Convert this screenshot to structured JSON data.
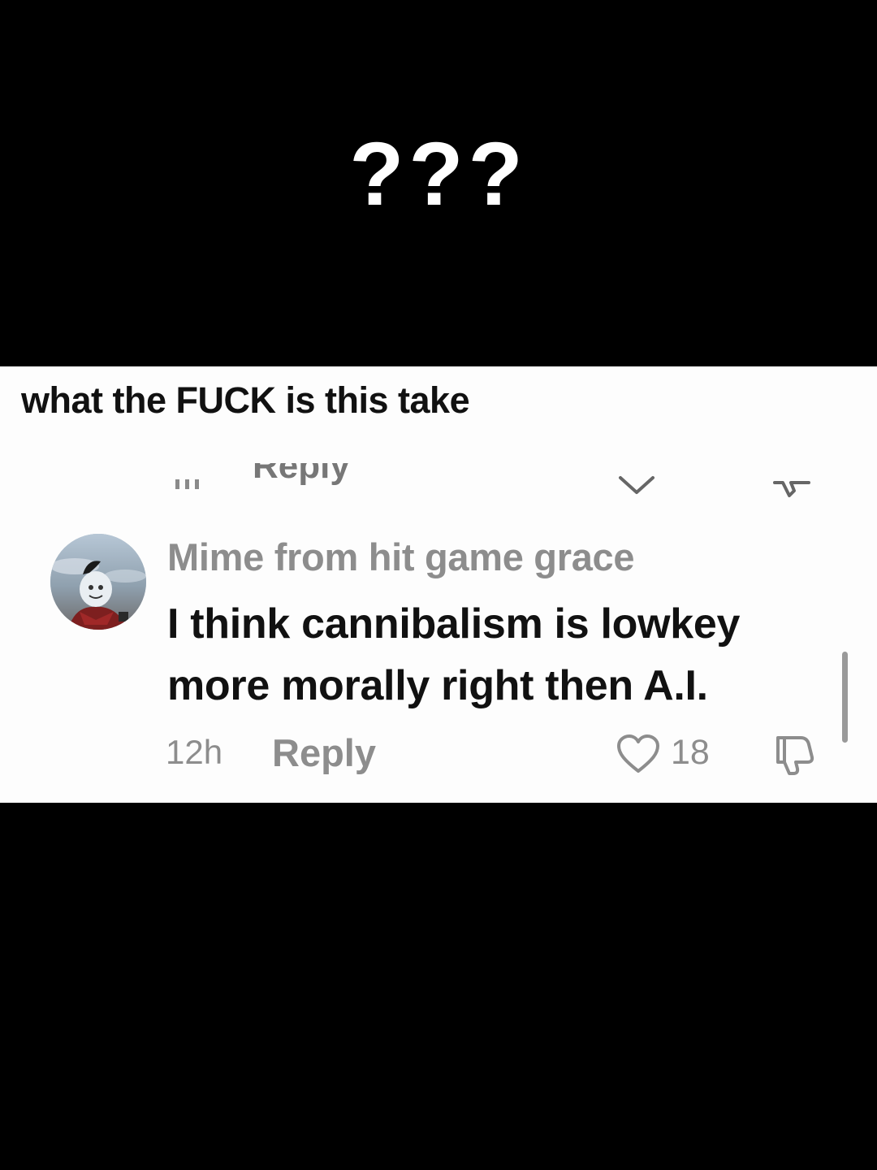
{
  "overlay": {
    "caption": "???"
  },
  "post": {
    "caption": "what the FUCK is this take"
  },
  "previous_comment": {
    "reply_label": "Reply"
  },
  "comment": {
    "username": "Mime from hit game grace",
    "text": "I think cannibalism is lowkey more morally right then A.I.",
    "time": "12h",
    "reply_label": "Reply",
    "like_count": "18",
    "icons": {
      "like": "heart-outline-icon",
      "dislike": "thumbs-down-outline-icon"
    }
  }
}
